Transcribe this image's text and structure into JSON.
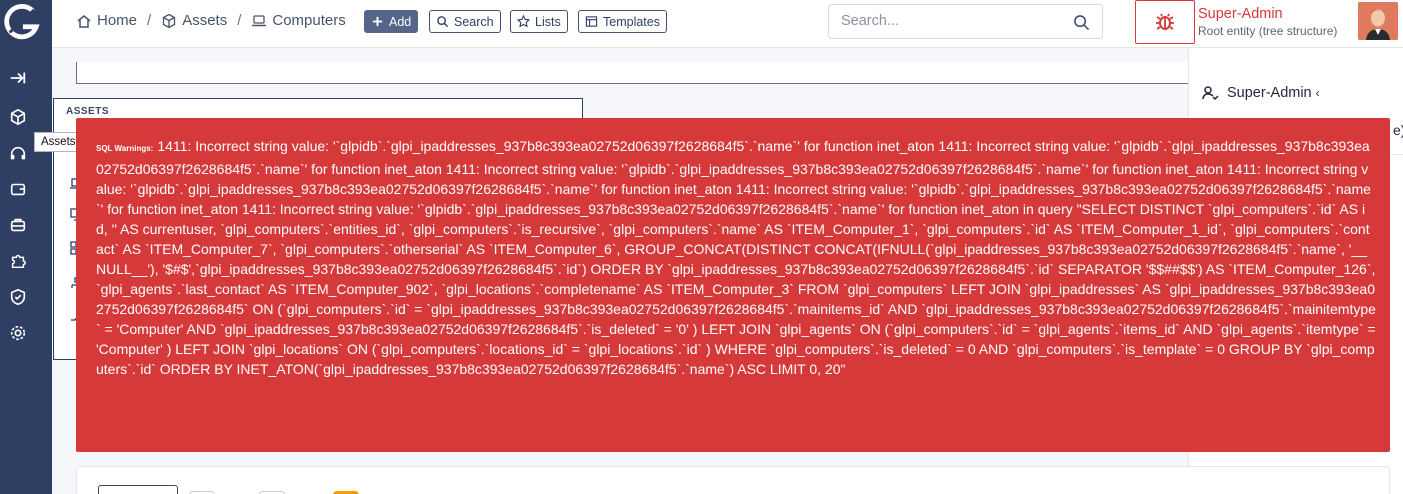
{
  "colors": {
    "rail": "#2f3f64",
    "alert": "#d63939",
    "primary_button": "#55658a",
    "accent_red": "#d63939"
  },
  "breadcrumb": [
    {
      "label": "Home",
      "icon": "home-icon"
    },
    {
      "label": "Assets",
      "icon": "cube-icon"
    },
    {
      "label": "Computers",
      "icon": "laptop-icon"
    }
  ],
  "toolbar": {
    "add_label": "Add",
    "search_label": "Search",
    "lists_label": "Lists",
    "templates_label": "Templates"
  },
  "search": {
    "placeholder": "Search..."
  },
  "user": {
    "name": "Super-Admin",
    "entity": "Root entity (tree structure)"
  },
  "dropdown": {
    "profile_item": "Super-Admin",
    "fragment": "e)"
  },
  "menu": {
    "header": "ASSETS",
    "tooltip": "Assets"
  },
  "alert": {
    "label": "SQL Warnings:",
    "message": "1411: Incorrect string value: '`glpidb`.`glpi_ipaddresses_937b8c393ea02752d06397f2628684f5`.`name`' for function inet_aton 1411: Incorrect string value: '`glpidb`.`glpi_ipaddresses_937b8c393ea02752d06397f2628684f5`.`name`' for function inet_aton 1411: Incorrect string value: '`glpidb`.`glpi_ipaddresses_937b8c393ea02752d06397f2628684f5`.`name`' for function inet_aton 1411: Incorrect string value: '`glpidb`.`glpi_ipaddresses_937b8c393ea02752d06397f2628684f5`.`name`' for function inet_aton 1411: Incorrect string value: '`glpidb`.`glpi_ipaddresses_937b8c393ea02752d06397f2628684f5`.`name`' for function inet_aton 1411: Incorrect string value: '`glpidb`.`glpi_ipaddresses_937b8c393ea02752d06397f2628684f5`.`name`' for function inet_aton in query \"SELECT DISTINCT `glpi_computers`.`id` AS id, '' AS currentuser, `glpi_computers`.`entities_id`, `glpi_computers`.`is_recursive`, `glpi_computers`.`name` AS `ITEM_Computer_1`, `glpi_computers`.`id` AS `ITEM_Computer_1_id`, `glpi_computers`.`contact` AS `ITEM_Computer_7`, `glpi_computers`.`otherserial` AS `ITEM_Computer_6`, GROUP_CONCAT(DISTINCT CONCAT(IFNULL(`glpi_ipaddresses_937b8c393ea02752d06397f2628684f5`.`name`, '__NULL__'), '$#$',`glpi_ipaddresses_937b8c393ea02752d06397f2628684f5`.`id`) ORDER BY `glpi_ipaddresses_937b8c393ea02752d06397f2628684f5`.`id` SEPARATOR '$$##$$') AS `ITEM_Computer_126`, `glpi_agents`.`last_contact` AS `ITEM_Computer_902`, `glpi_locations`.`completename` AS `ITEM_Computer_3` FROM `glpi_computers` LEFT JOIN `glpi_ipaddresses` AS `glpi_ipaddresses_937b8c393ea02752d06397f2628684f5` ON (`glpi_computers`.`id` = `glpi_ipaddresses_937b8c393ea02752d06397f2628684f5`.`mainitems_id` AND `glpi_ipaddresses_937b8c393ea02752d06397f2628684f5`.`mainitemtype` = 'Computer' AND `glpi_ipaddresses_937b8c393ea02752d06397f2628684f5`.`is_deleted` = '0' ) LEFT JOIN `glpi_agents` ON (`glpi_computers`.`id` = `glpi_agents`.`items_id` AND `glpi_agents`.`itemtype` = 'Computer' ) LEFT JOIN `glpi_locations` ON (`glpi_computers`.`locations_id` = `glpi_locations`.`id` ) WHERE `glpi_computers`.`is_deleted` = 0 AND `glpi_computers`.`is_template` = 0 GROUP BY `glpi_computers`.`id` ORDER BY INET_ATON(`glpi_ipaddresses_937b8c393ea02752d06397f2628684f5`.`name`) ASC LIMIT 0, 20\""
  }
}
